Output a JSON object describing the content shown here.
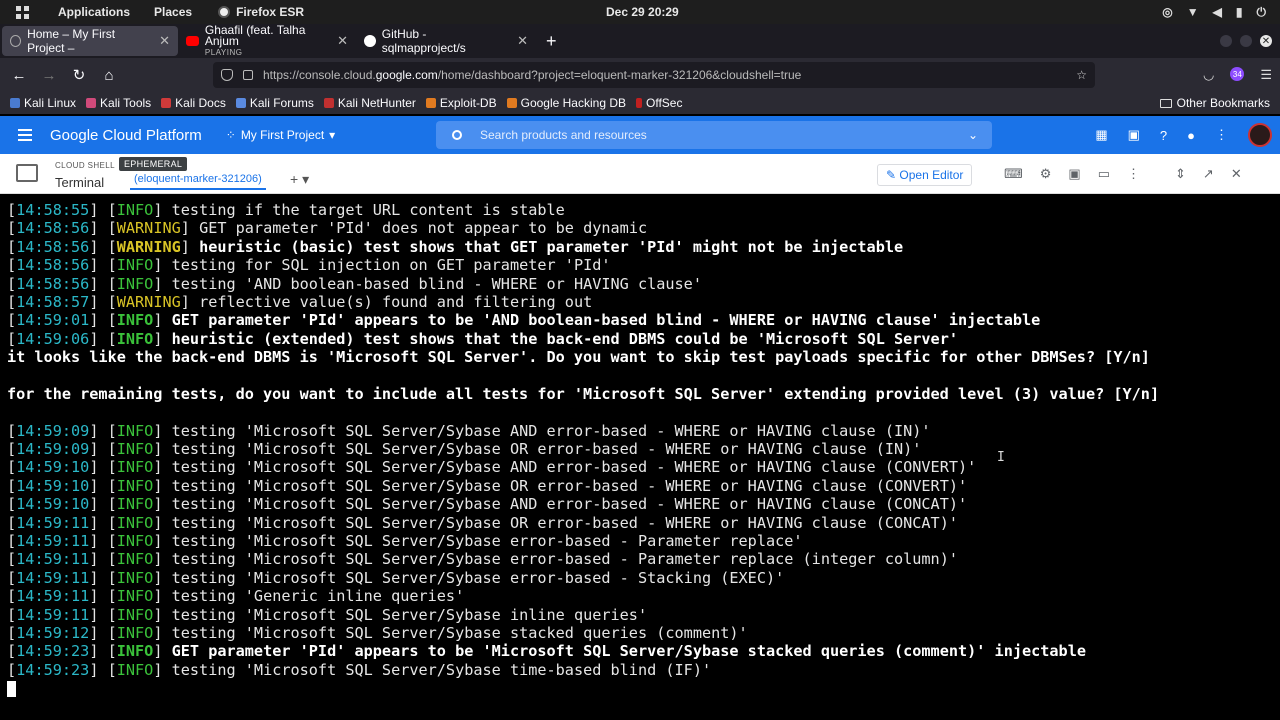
{
  "os_bar": {
    "applications": "Applications",
    "places": "Places",
    "browser_name": "Firefox ESR",
    "clock": "Dec 29  20:29"
  },
  "tabs": [
    {
      "title": "Home – My First Project –"
    },
    {
      "title": "Ghaafil (feat. Talha Anjum",
      "subtitle": "PLAYING"
    },
    {
      "title": "GitHub - sqlmapproject/s"
    }
  ],
  "url": {
    "prefix": "https://console.cloud.",
    "domain": "google.com",
    "suffix": "/home/dashboard?project=eloquent-marker-321206&cloudshell=true"
  },
  "extension_badge": "34",
  "bookmarks": [
    "Kali Linux",
    "Kali Tools",
    "Kali Docs",
    "Kali Forums",
    "Kali NetHunter",
    "Exploit-DB",
    "Google Hacking DB",
    "OffSec"
  ],
  "other_bookmarks": "Other Bookmarks",
  "gcp": {
    "title": "Google Cloud Platform",
    "project": "My First Project",
    "search_placeholder": "Search products and resources"
  },
  "shell": {
    "cloud_shell_label": "CLOUD SHELL",
    "ephemeral": "EPHEMERAL",
    "terminal_label": "Terminal",
    "tab_name": "(eloquent-marker-321206)",
    "open_editor": "Open Editor"
  },
  "terminal_lines": [
    {
      "t": "14:58:55",
      "lvl": "INFO",
      "msg": " testing if the target URL content is stable",
      "bold": false
    },
    {
      "t": "14:58:56",
      "lvl": "WARNING",
      "msg": " GET parameter 'PId' does not appear to be dynamic",
      "bold": false
    },
    {
      "t": "14:58:56",
      "lvl": "WARNING",
      "msg": " heuristic (basic) test shows that GET parameter 'PId' might not be injectable",
      "bold": true
    },
    {
      "t": "14:58:56",
      "lvl": "INFO",
      "msg": " testing for SQL injection on GET parameter 'PId'",
      "bold": false
    },
    {
      "t": "14:58:56",
      "lvl": "INFO",
      "msg": " testing 'AND boolean-based blind - WHERE or HAVING clause'",
      "bold": false
    },
    {
      "t": "14:58:57",
      "lvl": "WARNING",
      "msg": " reflective value(s) found and filtering out",
      "bold": false
    },
    {
      "t": "14:59:01",
      "lvl": "INFO",
      "msg": " GET parameter 'PId' appears to be 'AND boolean-based blind - WHERE or HAVING clause' injectable",
      "bold": true
    },
    {
      "t": "14:59:06",
      "lvl": "INFO",
      "msg": " heuristic (extended) test shows that the back-end DBMS could be 'Microsoft SQL Server'",
      "bold": true
    },
    {
      "raw": "it looks like the back-end DBMS is 'Microsoft SQL Server'. Do you want to skip test payloads specific for other DBMSes? [Y/n]",
      "bold": true
    },
    {
      "raw": ""
    },
    {
      "raw": "for the remaining tests, do you want to include all tests for 'Microsoft SQL Server' extending provided level (3) value? [Y/n]",
      "bold": true
    },
    {
      "raw": ""
    },
    {
      "t": "14:59:09",
      "lvl": "INFO",
      "msg": " testing 'Microsoft SQL Server/Sybase AND error-based - WHERE or HAVING clause (IN)'",
      "bold": false
    },
    {
      "t": "14:59:09",
      "lvl": "INFO",
      "msg": " testing 'Microsoft SQL Server/Sybase OR error-based - WHERE or HAVING clause (IN)'",
      "bold": false
    },
    {
      "t": "14:59:10",
      "lvl": "INFO",
      "msg": " testing 'Microsoft SQL Server/Sybase AND error-based - WHERE or HAVING clause (CONVERT)'",
      "bold": false
    },
    {
      "t": "14:59:10",
      "lvl": "INFO",
      "msg": " testing 'Microsoft SQL Server/Sybase OR error-based - WHERE or HAVING clause (CONVERT)'",
      "bold": false
    },
    {
      "t": "14:59:10",
      "lvl": "INFO",
      "msg": " testing 'Microsoft SQL Server/Sybase AND error-based - WHERE or HAVING clause (CONCAT)'",
      "bold": false
    },
    {
      "t": "14:59:11",
      "lvl": "INFO",
      "msg": " testing 'Microsoft SQL Server/Sybase OR error-based - WHERE or HAVING clause (CONCAT)'",
      "bold": false
    },
    {
      "t": "14:59:11",
      "lvl": "INFO",
      "msg": " testing 'Microsoft SQL Server/Sybase error-based - Parameter replace'",
      "bold": false
    },
    {
      "t": "14:59:11",
      "lvl": "INFO",
      "msg": " testing 'Microsoft SQL Server/Sybase error-based - Parameter replace (integer column)'",
      "bold": false
    },
    {
      "t": "14:59:11",
      "lvl": "INFO",
      "msg": " testing 'Microsoft SQL Server/Sybase error-based - Stacking (EXEC)'",
      "bold": false
    },
    {
      "t": "14:59:11",
      "lvl": "INFO",
      "msg": " testing 'Generic inline queries'",
      "bold": false
    },
    {
      "t": "14:59:11",
      "lvl": "INFO",
      "msg": " testing 'Microsoft SQL Server/Sybase inline queries'",
      "bold": false
    },
    {
      "t": "14:59:12",
      "lvl": "INFO",
      "msg": " testing 'Microsoft SQL Server/Sybase stacked queries (comment)'",
      "bold": false
    },
    {
      "t": "14:59:23",
      "lvl": "INFO",
      "msg": " GET parameter 'PId' appears to be 'Microsoft SQL Server/Sybase stacked queries (comment)' injectable",
      "bold": true
    },
    {
      "t": "14:59:23",
      "lvl": "INFO",
      "msg": " testing 'Microsoft SQL Server/Sybase time-based blind (IF)'",
      "bold": false
    }
  ]
}
